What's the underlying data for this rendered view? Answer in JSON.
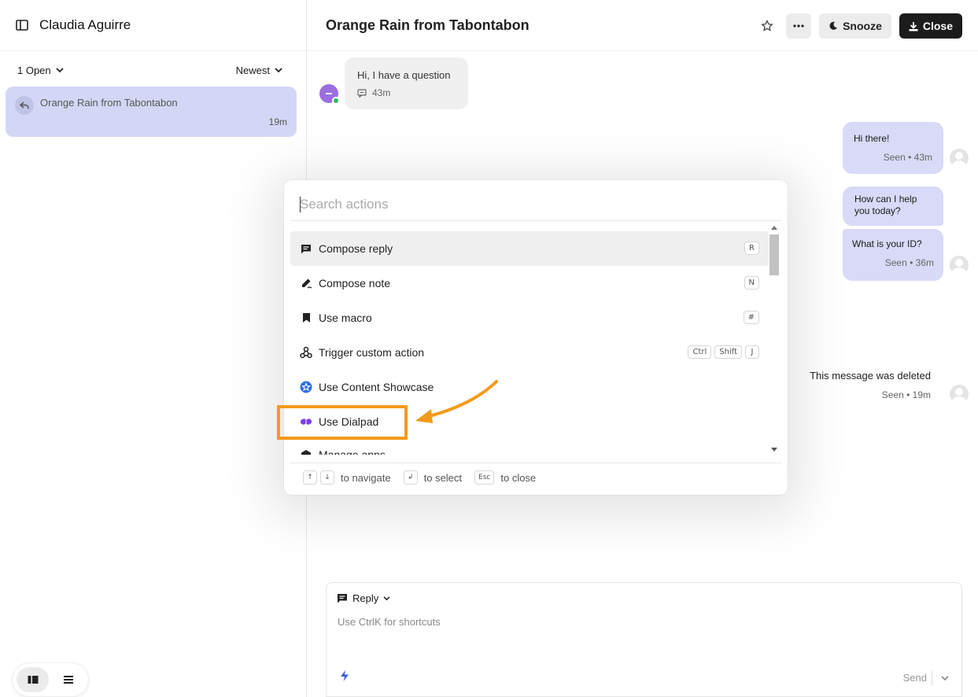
{
  "sidebar": {
    "agent_name": "Claudia Aguirre",
    "filter_status": "1 Open",
    "filter_sort": "Newest",
    "conversation": {
      "title": "Orange Rain from Tabontabon",
      "time": "19m"
    }
  },
  "header": {
    "title": "Orange Rain from Tabontabon",
    "snooze_label": "Snooze",
    "close_label": "Close"
  },
  "messages": {
    "incoming": {
      "text": "Hi, I have a question",
      "time": "43m"
    },
    "outgoing": [
      {
        "text": "Hi there!",
        "meta": "Seen • 43m"
      },
      {
        "text": "How can I help you today?",
        "meta": ""
      },
      {
        "text": "What is your ID?",
        "meta": "Seen • 36m"
      }
    ],
    "deleted": {
      "text": "This message was deleted",
      "meta": "Seen • 19m"
    }
  },
  "reply": {
    "type_label": "Reply",
    "placeholder": "Use CtrlK for shortcuts",
    "send_label": "Send"
  },
  "palette": {
    "search_placeholder": "Search actions",
    "items": [
      {
        "label": "Compose reply",
        "keys": [
          "R"
        ],
        "icon": "compose-reply-icon"
      },
      {
        "label": "Compose note",
        "keys": [
          "N"
        ],
        "icon": "compose-note-icon"
      },
      {
        "label": "Use macro",
        "keys": [
          "#"
        ],
        "icon": "bookmark-icon"
      },
      {
        "label": "Trigger custom action",
        "keys": [
          "Ctrl",
          "Shift",
          "J"
        ],
        "icon": "webhook-icon"
      },
      {
        "label": "Use Content Showcase",
        "keys": [],
        "icon": "content-showcase-icon"
      },
      {
        "label": "Use Dialpad",
        "keys": [],
        "icon": "dialpad-icon"
      },
      {
        "label": "Manage apps",
        "keys": [],
        "icon": "apps-icon"
      }
    ],
    "hints": {
      "up": "↑",
      "down": "↓",
      "navigate": "to navigate",
      "enter": "↲",
      "select": "to select",
      "esc": "Esc",
      "close": "to close"
    }
  },
  "colors": {
    "accent_highlight": "#f39a1a",
    "bubble_out": "#d8daf7",
    "conversation_card": "#d3d7f5",
    "dialpad_purple": "#7b3fe4",
    "showcase_blue": "#2b6fe6",
    "online_green": "#2fb85f"
  }
}
